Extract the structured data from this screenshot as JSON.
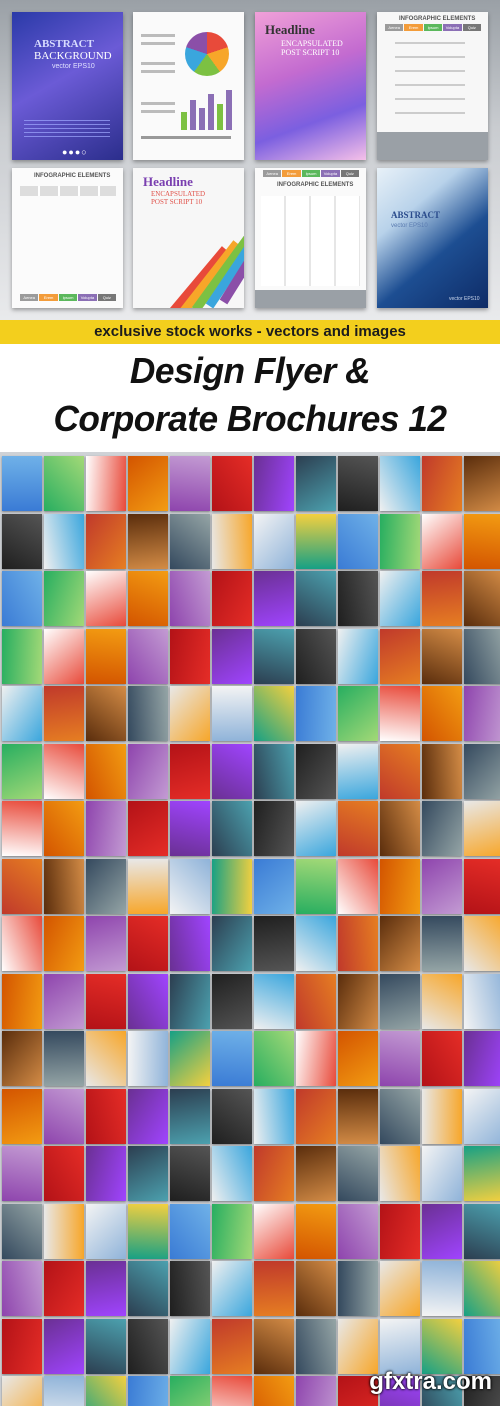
{
  "preview_top": {
    "card1": {
      "line1": "ABSTRACT",
      "line2": "BACKGROUND",
      "line3": "vector EPS10"
    },
    "card3": {
      "headline": "Headline",
      "sub1": "ENCAPSULATED",
      "sub2": "POST SCRIPT 10"
    },
    "card4": {
      "heading": "INFOGRAPHIC ELEMENTS",
      "tabs": [
        "Aenea",
        "Erem",
        "Ipsum",
        "Volupta",
        "Quiz"
      ]
    },
    "card5": {
      "heading": "INFOGRAPHIC ELEMENTS",
      "tabs": [
        "Aenea",
        "Erem",
        "Ipsum",
        "Volupta",
        "Quiz"
      ]
    },
    "card6": {
      "headline": "Headline",
      "sub1": "ENCAPSULATED",
      "sub2": "POST SCRIPT 10"
    },
    "card7": {
      "heading": "INFOGRAPHIC ELEMENTS",
      "tabs": [
        "Aenea",
        "Erem",
        "Ipsum",
        "Volupta",
        "Quiz"
      ]
    },
    "card8": {
      "line1": "ABSTRACT",
      "line2": "vector EPS10",
      "footer": "vector EPS10"
    }
  },
  "banner": {
    "text": "exclusive stock works - vectors and images"
  },
  "title": {
    "line1": "Design Flyer &",
    "line2": "Corporate Brochures 12"
  },
  "watermark": {
    "text": "gfxtra.com"
  },
  "colors": {
    "banner_bg": "#f3cf1d",
    "title": "#111111"
  }
}
